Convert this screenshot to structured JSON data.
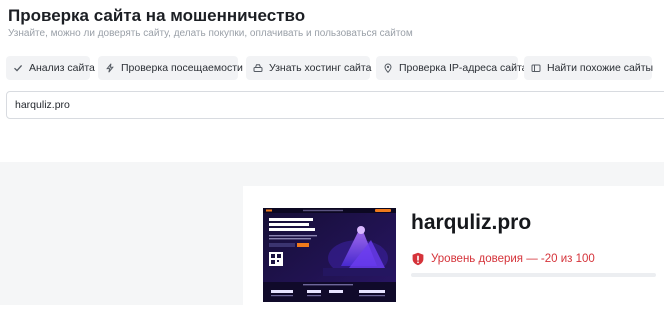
{
  "header": {
    "title": "Проверка сайта на мошенничество",
    "subtitle": "Узнайте, можно ли доверять сайту, делать покупки, оплачивать и пользоваться сайтом"
  },
  "tabs": [
    {
      "label": "Анализ сайта",
      "icon": "check-icon"
    },
    {
      "label": "Проверка посещаемости",
      "icon": "lightning-icon"
    },
    {
      "label": "Узнать хостинг сайта",
      "icon": "server-icon"
    },
    {
      "label": "Проверка IP-адреса сайта",
      "icon": "location-pin-icon"
    },
    {
      "label": "Найти похожие сайты",
      "icon": "window-icon"
    }
  ],
  "search": {
    "value": "harquliz.pro"
  },
  "result": {
    "domain": "harquliz.pro",
    "trust_text": "Уровень доверия — -20 из 100",
    "trust_score": -20,
    "trust_max": 100,
    "trust_color": "#d5333a"
  },
  "colors": {
    "tab_bg": "#f2f3f5",
    "section_bg": "#f5f6f7",
    "thumb_bg": "#1a1240",
    "thumb_accent": "#f07a1c"
  }
}
